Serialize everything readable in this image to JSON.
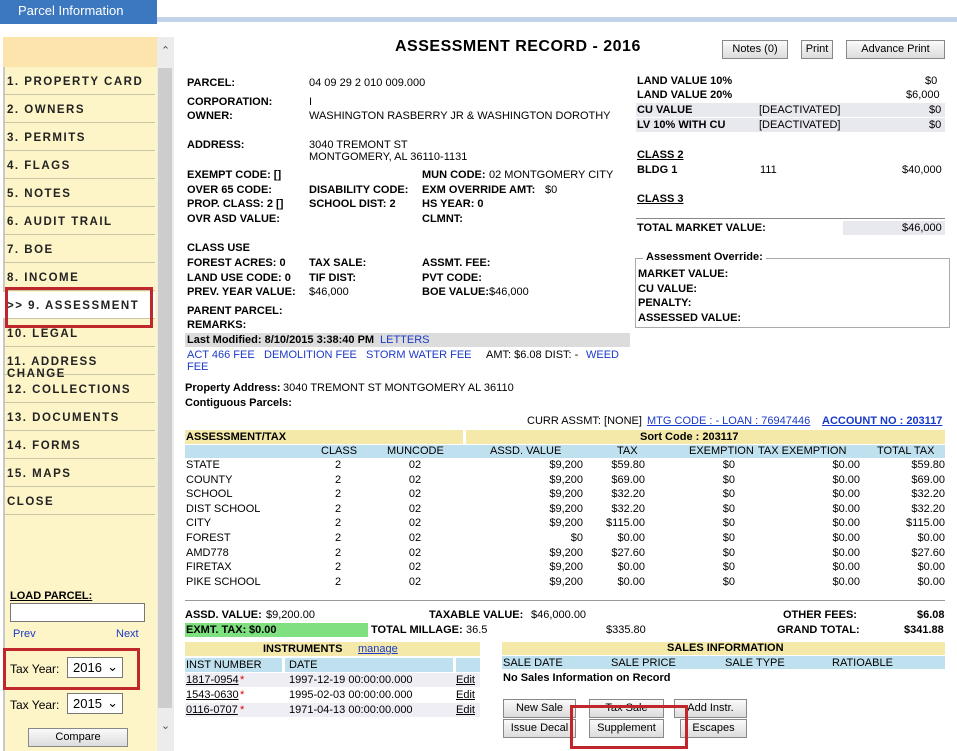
{
  "window_tab": "Parcel Information",
  "sidebar": {
    "items": [
      {
        "label": "1. PROPERTY CARD"
      },
      {
        "label": "2. OWNERS"
      },
      {
        "label": "3. PERMITS"
      },
      {
        "label": "4. FLAGS"
      },
      {
        "label": "5. NOTES"
      },
      {
        "label": "6. AUDIT TRAIL"
      },
      {
        "label": "7. BOE"
      },
      {
        "label": "8. INCOME"
      },
      {
        "label": ">> 9. ASSESSMENT"
      },
      {
        "label": "10. LEGAL"
      },
      {
        "label": "11. ADDRESS CHANGE"
      },
      {
        "label": "12. COLLECTIONS"
      },
      {
        "label": "13. DOCUMENTS"
      },
      {
        "label": "14. FORMS"
      },
      {
        "label": "15. MAPS"
      },
      {
        "label": "CLOSE"
      }
    ],
    "load_parcel_label": "LOAD PARCEL:",
    "load_parcel_value": "",
    "prev": "Prev",
    "next": "Next",
    "tax_year_label": "Tax Year:",
    "tax_year_1": "2016",
    "tax_year_2": "2015",
    "compare": "Compare"
  },
  "header": {
    "title": "ASSESSMENT RECORD - 2016",
    "notes_btn": "Notes (0)",
    "print_btn": "Print",
    "advance_print_btn": "Advance Print"
  },
  "parcel": {
    "parcel_label": "PARCEL:",
    "parcel_value": "04 09 29 2 010 009.000",
    "corporation_label": "CORPORATION:",
    "corporation_value": "I",
    "owner_label": "OWNER:",
    "owner_value": "WASHINGTON RASBERRY JR & WASHINGTON DOROTHY",
    "address_label": "ADDRESS:",
    "address_line1": "3040 TREMONT ST",
    "address_line2": "MONTGOMERY, AL  36110-1131",
    "exempt_code": "EXEMPT CODE:  []",
    "mun_code_label": "MUN CODE:",
    "mun_code_value": "02  MONTGOMERY CITY",
    "over65": "OVER 65 CODE:",
    "disability": "DISABILITY CODE:",
    "exm_override_label": "EXM OVERRIDE AMT:",
    "exm_override_value": "$0",
    "prop_class": "PROP. CLASS: 2  []",
    "school_dist": "SCHOOL DIST: 2",
    "hs_year": "HS YEAR: 0",
    "ovr_asd": "OVR ASD VALUE:",
    "clmnt": "CLMNT:",
    "class_use": "CLASS USE",
    "forest_acres": "FOREST ACRES: 0",
    "tax_sale": "TAX SALE:",
    "assmt_fee": "ASSMT. FEE:",
    "land_use_code": "LAND USE CODE: 0",
    "tif_dist": "TIF DIST:",
    "pvt_code": "PVT CODE:",
    "prev_year_label": "PREV. YEAR VALUE:",
    "prev_year_value": "$46,000",
    "boe_label": "BOE VALUE:",
    "boe_value": "$46,000",
    "parent_parcel": "PARENT PARCEL:",
    "remarks": "REMARKS:",
    "last_modified": "Last Modified: 8/10/2015 3:38:40 PM",
    "letters": "LETTERS",
    "fees_links": [
      "ACT 466 FEE",
      "DEMOLITION FEE",
      "STORM WATER FEE"
    ],
    "amt_dist": "AMT: $6.08 DIST: -",
    "weed_fee_1": "WEED",
    "weed_fee_2": "FEE",
    "property_address_label": "Property Address:",
    "property_address_value": "3040 TREMONT ST  MONTGOMERY AL 36110",
    "contiguous": "Contiguous Parcels:"
  },
  "values": {
    "land10_label": "LAND VALUE 10%",
    "land10_value": "$0",
    "land20_label": "LAND VALUE 20%",
    "land20_value": "$6,000",
    "cu_label": "CU VALUE",
    "cu_status": "[DEACTIVATED]",
    "cu_value": "$0",
    "lv10cu_label": "LV 10% WITH CU",
    "lv10cu_status": "[DEACTIVATED]",
    "lv10cu_value": "$0",
    "class2": "CLASS 2",
    "bldg_label": "BLDG 1",
    "bldg_code": "111",
    "bldg_value": "$40,000",
    "class3": "CLASS 3",
    "total_market_label": "TOTAL MARKET VALUE:",
    "total_market_value": "$46,000",
    "override_title": "Assessment Override:",
    "override_market": "MARKET VALUE:",
    "override_cu": "CU VALUE:",
    "override_penalty": "PENALTY:",
    "override_assessed": "ASSESSED VALUE:"
  },
  "curr_assmt": {
    "prefix": "CURR ASSMT: [NONE]",
    "mtg": "MTG CODE : - LOAN : 76947446",
    "account": "ACCOUNT NO : 203117"
  },
  "tax_table": {
    "title": "ASSESSMENT/TAX",
    "sort_code": "Sort Code : 203117",
    "columns": [
      "CLASS",
      "MUNCODE",
      "ASSD. VALUE",
      "TAX",
      "EXEMPTION",
      "TAX EXEMPTION",
      "TOTAL TAX"
    ],
    "rows": [
      [
        "STATE",
        "2",
        "02",
        "$9,200",
        "$59.80",
        "$0",
        "$0.00",
        "$59.80"
      ],
      [
        "COUNTY",
        "2",
        "02",
        "$9,200",
        "$69.00",
        "$0",
        "$0.00",
        "$69.00"
      ],
      [
        "SCHOOL",
        "2",
        "02",
        "$9,200",
        "$32.20",
        "$0",
        "$0.00",
        "$32.20"
      ],
      [
        "DIST SCHOOL",
        "2",
        "02",
        "$9,200",
        "$32.20",
        "$0",
        "$0.00",
        "$32.20"
      ],
      [
        "CITY",
        "2",
        "02",
        "$9,200",
        "$115.00",
        "$0",
        "$0.00",
        "$115.00"
      ],
      [
        "FOREST",
        "2",
        "02",
        "$0",
        "$0.00",
        "$0",
        "$0.00",
        "$0.00"
      ],
      [
        "AMD778",
        "2",
        "02",
        "$9,200",
        "$27.60",
        "$0",
        "$0.00",
        "$27.60"
      ],
      [
        "FIRETAX",
        "2",
        "02",
        "$9,200",
        "$0.00",
        "$0",
        "$0.00",
        "$0.00"
      ],
      [
        "PIKE SCHOOL",
        "2",
        "02",
        "$9,200",
        "$0.00",
        "$0",
        "$0.00",
        "$0.00"
      ]
    ]
  },
  "totals": {
    "assd_label": "ASSD. VALUE:",
    "assd_value": "$9,200.00",
    "taxable_label": "TAXABLE VALUE:",
    "taxable_value": "$46,000.00",
    "other_fees_label": "OTHER FEES:",
    "other_fees_value": "$6.08",
    "exmt_tax_label": "EXMT. TAX:",
    "exmt_tax_value": "$0.00",
    "millage_label": "TOTAL MILLAGE:",
    "millage_value": "36.5",
    "subtotal": "$335.80",
    "grand_total_label": "GRAND TOTAL:",
    "grand_total_value": "$341.88"
  },
  "instruments": {
    "title": "INSTRUMENTS",
    "manage": "manage",
    "col_inst": "INST NUMBER",
    "col_date": "DATE",
    "rows": [
      {
        "inst": "1817-0954",
        "date": "1997-12-19 00:00:00.000",
        "edit": "Edit"
      },
      {
        "inst": "1543-0630",
        "date": "1995-02-03 00:00:00.000",
        "edit": "Edit"
      },
      {
        "inst": "0116-0707",
        "date": "1971-04-13 00:00:00.000",
        "edit": "Edit"
      }
    ]
  },
  "sales": {
    "title": "SALES INFORMATION",
    "columns": [
      "SALE DATE",
      "SALE PRICE",
      "SALE TYPE",
      "RATIOABLE"
    ],
    "empty": "No Sales Information on Record"
  },
  "buttons": {
    "new_sale": "New Sale",
    "tax_sale": "Tax Sale",
    "add_instr": "Add Instr.",
    "issue_decal": "Issue Decal",
    "supplement": "Supplement",
    "escapes": "Escapes"
  },
  "colors": {
    "accent": "#3c78c0",
    "highlight": "#c0272d",
    "link": "#1a39c8",
    "green": "#7fe07f"
  }
}
